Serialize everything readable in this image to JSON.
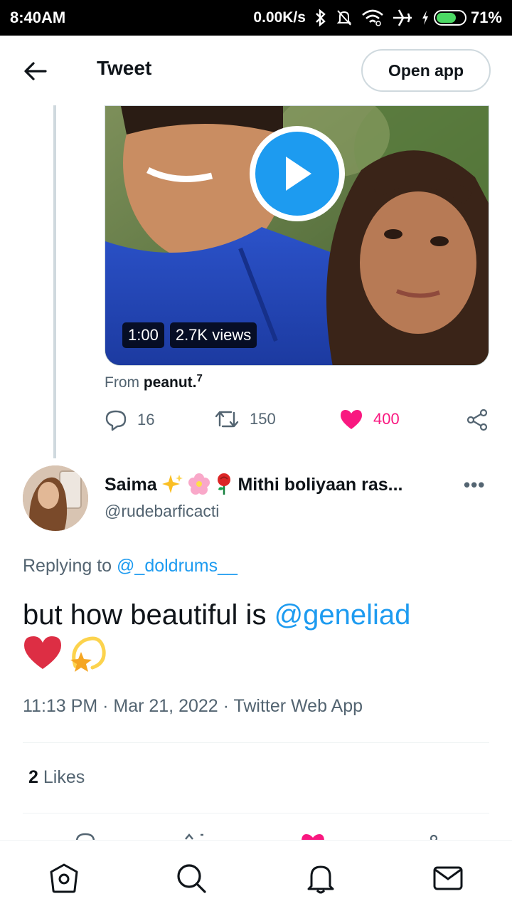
{
  "status_bar": {
    "time": "8:40AM",
    "network_speed": "0.00K/s",
    "battery_percent": "71%",
    "battery_level": 0.71,
    "icons": [
      "bluetooth-icon",
      "mute-icon",
      "wifi-icon",
      "airplane-icon",
      "charging-icon",
      "battery-icon"
    ]
  },
  "header": {
    "title": "Tweet",
    "open_app_label": "Open app"
  },
  "video": {
    "duration": "1:00",
    "views": "2.7K views"
  },
  "source": {
    "prefix": "From",
    "name": "peanut.",
    "superscript": "7"
  },
  "parent_actions": {
    "replies": "16",
    "retweets": "150",
    "likes": "400"
  },
  "reply": {
    "author_name_1": "Saima",
    "author_name_2": "Mithi boliyaan ras...",
    "handle": "@rudebarficacti",
    "replying_prefix": "Replying to",
    "replying_to": "@_doldrums__",
    "text_prefix": "but how beautiful is ",
    "text_mention": "@geneliad",
    "timestamp": "11:13 PM · Mar 21, 2022 · Twitter Web App",
    "likes_count": "2",
    "likes_label": "Likes"
  },
  "colors": {
    "accent": "#1d9bf0",
    "like": "#f91880",
    "secondary_text": "#536471",
    "divider": "#eff3f4"
  },
  "bottom_nav": [
    "home-icon",
    "search-icon",
    "notifications-icon",
    "messages-icon"
  ]
}
